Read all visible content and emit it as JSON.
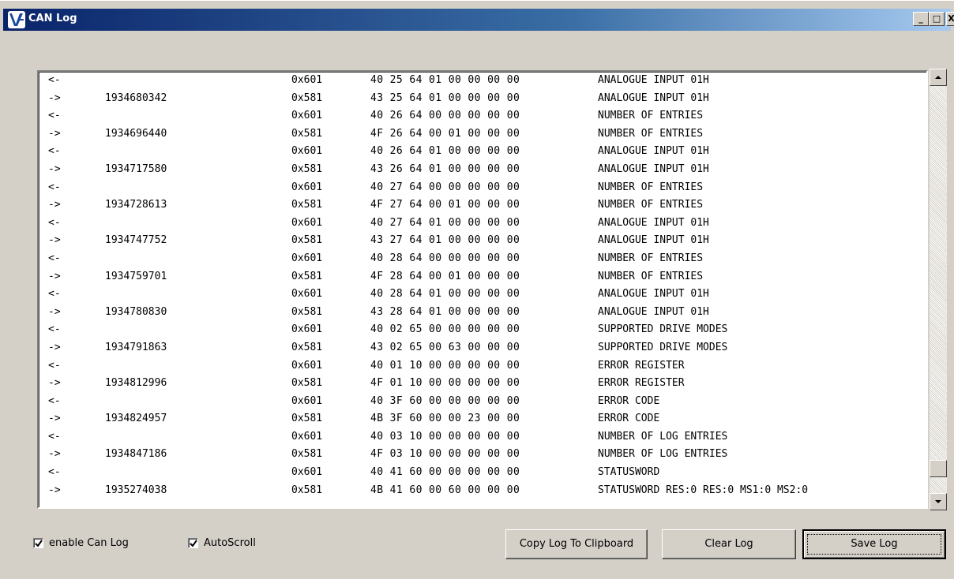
{
  "window": {
    "title": "CAN Log",
    "minimize_label": "_",
    "maximize_label": "□",
    "close_label": "X"
  },
  "log": {
    "rows": [
      {
        "dir": "<-",
        "ts": "",
        "id": "0x601",
        "bytes": "40 25 64 01 00 00 00 00",
        "desc": "ANALOGUE INPUT 01H"
      },
      {
        "dir": "->",
        "ts": "1934680342",
        "id": "0x581",
        "bytes": "43 25 64 01 00 00 00 00",
        "desc": "ANALOGUE INPUT 01H"
      },
      {
        "dir": "<-",
        "ts": "",
        "id": "0x601",
        "bytes": "40 26 64 00 00 00 00 00",
        "desc": "NUMBER OF ENTRIES"
      },
      {
        "dir": "->",
        "ts": "1934696440",
        "id": "0x581",
        "bytes": "4F 26 64 00 01 00 00 00",
        "desc": "NUMBER OF ENTRIES"
      },
      {
        "dir": "<-",
        "ts": "",
        "id": "0x601",
        "bytes": "40 26 64 01 00 00 00 00",
        "desc": "ANALOGUE INPUT 01H"
      },
      {
        "dir": "->",
        "ts": "1934717580",
        "id": "0x581",
        "bytes": "43 26 64 01 00 00 00 00",
        "desc": "ANALOGUE INPUT 01H"
      },
      {
        "dir": "<-",
        "ts": "",
        "id": "0x601",
        "bytes": "40 27 64 00 00 00 00 00",
        "desc": "NUMBER OF ENTRIES"
      },
      {
        "dir": "->",
        "ts": "1934728613",
        "id": "0x581",
        "bytes": "4F 27 64 00 01 00 00 00",
        "desc": "NUMBER OF ENTRIES"
      },
      {
        "dir": "<-",
        "ts": "",
        "id": "0x601",
        "bytes": "40 27 64 01 00 00 00 00",
        "desc": "ANALOGUE INPUT 01H"
      },
      {
        "dir": "->",
        "ts": "1934747752",
        "id": "0x581",
        "bytes": "43 27 64 01 00 00 00 00",
        "desc": "ANALOGUE INPUT 01H"
      },
      {
        "dir": "<-",
        "ts": "",
        "id": "0x601",
        "bytes": "40 28 64 00 00 00 00 00",
        "desc": "NUMBER OF ENTRIES"
      },
      {
        "dir": "->",
        "ts": "1934759701",
        "id": "0x581",
        "bytes": "4F 28 64 00 01 00 00 00",
        "desc": "NUMBER OF ENTRIES"
      },
      {
        "dir": "<-",
        "ts": "",
        "id": "0x601",
        "bytes": "40 28 64 01 00 00 00 00",
        "desc": "ANALOGUE INPUT 01H"
      },
      {
        "dir": "->",
        "ts": "1934780830",
        "id": "0x581",
        "bytes": "43 28 64 01 00 00 00 00",
        "desc": "ANALOGUE INPUT 01H"
      },
      {
        "dir": "<-",
        "ts": "",
        "id": "0x601",
        "bytes": "40 02 65 00 00 00 00 00",
        "desc": "SUPPORTED DRIVE MODES"
      },
      {
        "dir": "->",
        "ts": "1934791863",
        "id": "0x581",
        "bytes": "43 02 65 00 63 00 00 00",
        "desc": "SUPPORTED DRIVE MODES"
      },
      {
        "dir": "<-",
        "ts": "",
        "id": "0x601",
        "bytes": "40 01 10 00 00 00 00 00",
        "desc": "ERROR REGISTER"
      },
      {
        "dir": "->",
        "ts": "1934812996",
        "id": "0x581",
        "bytes": "4F 01 10 00 00 00 00 00",
        "desc": "ERROR REGISTER"
      },
      {
        "dir": "<-",
        "ts": "",
        "id": "0x601",
        "bytes": "40 3F 60 00 00 00 00 00",
        "desc": "ERROR CODE"
      },
      {
        "dir": "->",
        "ts": "1934824957",
        "id": "0x581",
        "bytes": "4B 3F 60 00 00 23 00 00",
        "desc": "ERROR CODE"
      },
      {
        "dir": "<-",
        "ts": "",
        "id": "0x601",
        "bytes": "40 03 10 00 00 00 00 00",
        "desc": "NUMBER OF LOG ENTRIES"
      },
      {
        "dir": "->",
        "ts": "1934847186",
        "id": "0x581",
        "bytes": "4F 03 10 00 00 00 00 00",
        "desc": "NUMBER OF LOG ENTRIES"
      },
      {
        "dir": "<-",
        "ts": "",
        "id": "0x601",
        "bytes": "40 41 60 00 00 00 00 00",
        "desc": "STATUSWORD"
      },
      {
        "dir": "->",
        "ts": "1935274038",
        "id": "0x581",
        "bytes": "4B 41 60 00 60 00 00 00",
        "desc": "STATUSWORD RES:0 RES:0 MS1:0 MS2:0"
      }
    ]
  },
  "controls": {
    "enable_can_log_label": "enable Can Log",
    "enable_can_log_checked": true,
    "autoscroll_label": "AutoScroll",
    "autoscroll_checked": true,
    "copy_label": "Copy Log To Clipboard",
    "clear_label": "Clear Log",
    "save_label": "Save Log"
  },
  "colors": {
    "title_gradient_start": "#0a246a",
    "title_gradient_end": "#a6caf0",
    "window_face": "#d4d0c8"
  },
  "icons": {
    "app": "v-logo-icon",
    "scroll_up": "arrow-up-icon",
    "scroll_down": "arrow-down-icon",
    "check": "checkmark-icon"
  }
}
